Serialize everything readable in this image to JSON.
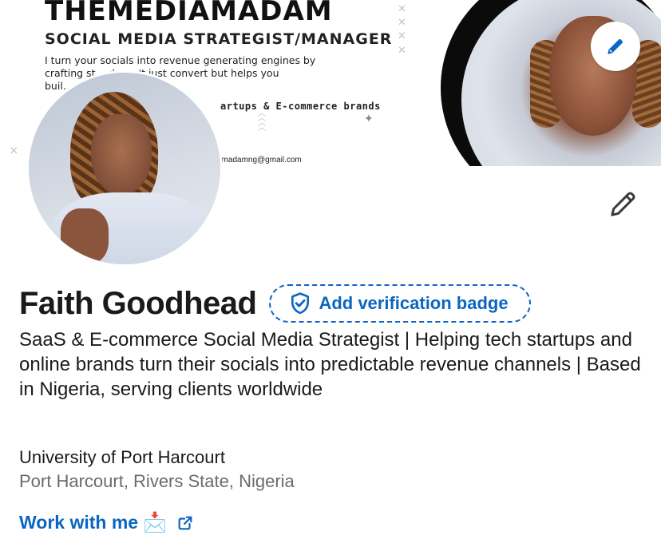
{
  "banner": {
    "brand": "THEMEDIAMADAM",
    "role": "SOCIAL MEDIA STRATEGIST/MANAGER",
    "pitch_line1": "I turn your socials into revenue generating engines by",
    "pitch_line2": "crafting st… doesn't just convert but helps you",
    "pitch_line3": "buil…",
    "niche": "artups & E-commerce brands",
    "email": "amadamng@gmail.com",
    "edit_icon": "pencil-icon"
  },
  "profile": {
    "name": "Faith Goodhead",
    "verification_label": "Add verification badge",
    "headline": "SaaS & E-commerce Social Media Strategist | Helping tech startups and online brands turn their socials into predictable revenue channels | Based in Nigeria, serving clients worldwide",
    "education": "University of Port Harcourt",
    "location": "Port Harcourt, Rivers State, Nigeria",
    "cta_label": "Work with me",
    "cta_emoji": "📩",
    "edit_icon": "pencil-icon"
  },
  "colors": {
    "accent": "#0a66c2",
    "text_primary": "#1a1a1a",
    "text_secondary": "#6b6b6b"
  }
}
